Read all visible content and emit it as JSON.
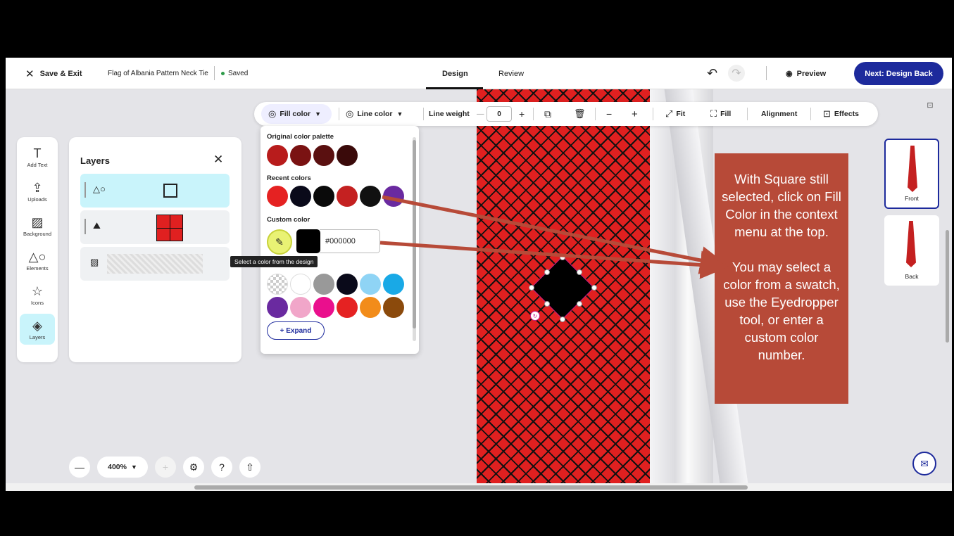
{
  "topbar": {
    "save_exit": "Save & Exit",
    "doc_title": "Flag of Albania Pattern Neck Tie",
    "saved": "Saved",
    "tabs": [
      "Design",
      "Review"
    ],
    "preview": "Preview",
    "next_button": "Next: Design Back"
  },
  "context_toolbar": {
    "fill_color": "Fill color",
    "line_color": "Line color",
    "line_weight": "Line weight",
    "line_weight_value": "0",
    "fit": "Fit",
    "fill": "Fill",
    "alignment": "Alignment",
    "effects": "Effects"
  },
  "rail": {
    "items": [
      "Add Text",
      "Uploads",
      "Background",
      "Elements",
      "Icons",
      "Layers"
    ]
  },
  "layers": {
    "title": "Layers"
  },
  "color_popover": {
    "original_label": "Original color palette",
    "original_colors": [
      "#b81c1c",
      "#7a1212",
      "#5a1010",
      "#3a0a0a"
    ],
    "recent_label": "Recent colors",
    "recent_colors": [
      "#e52222",
      "#0a0a1a",
      "#0a0a0a",
      "#c42121",
      "#111111",
      "#6a2aa0"
    ],
    "custom_label": "Custom color",
    "hex_value": "#000000",
    "tooltip": "Select a color from the design",
    "swatches_row1": [
      "transparent",
      "#ffffff",
      "#999999",
      "#0a0a1a",
      "#8fd4f5",
      "#19a9e6"
    ],
    "swatches_row2": [
      "#6a2aa0",
      "#f1a6c9",
      "#ea0f8d",
      "#e52222",
      "#f28c1a",
      "#8b4a0c"
    ],
    "expand": "+ Expand"
  },
  "annotation": {
    "p1": "With Square still selected, click on Fill Color in the context menu at the top.",
    "p2": "You may select a color from a swatch, use the Eyedropper tool, or enter a custom color number."
  },
  "views": [
    "Front",
    "Back"
  ],
  "zoom": "400%",
  "colors": {
    "brand": "#1d2a9c",
    "tie_red": "#e02020",
    "note_bg": "#b74a38",
    "arrow": "#b74a38"
  }
}
